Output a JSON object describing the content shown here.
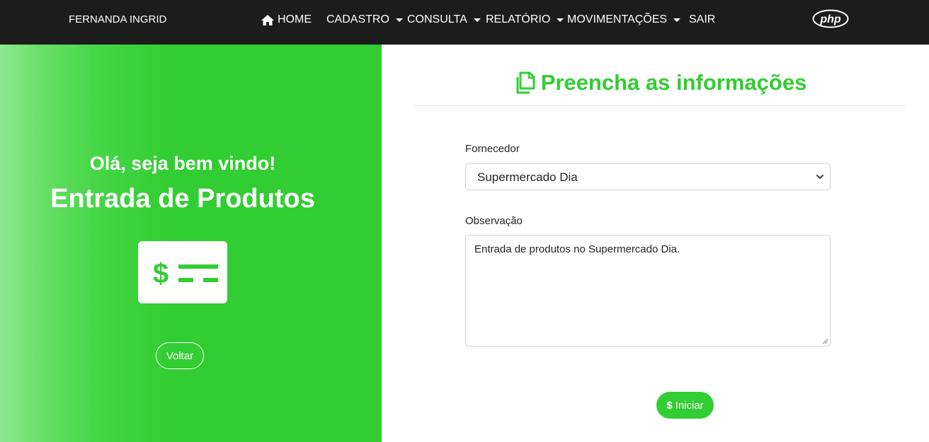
{
  "navbar": {
    "brand": "FERNANDA INGRID",
    "items": [
      {
        "label": "HOME",
        "icon": "home-icon",
        "dropdown": false
      },
      {
        "label": "CADASTRO",
        "dropdown": true
      },
      {
        "label": "CONSULTA",
        "dropdown": true
      },
      {
        "label": "RELATÓRIO",
        "dropdown": true
      },
      {
        "label": "MOVIMENTAÇÕES",
        "dropdown": true
      },
      {
        "label": "SAIR",
        "dropdown": false
      }
    ],
    "logo_text": "php"
  },
  "left_panel": {
    "welcome": "Olá, seja bem vindo!",
    "title": "Entrada de Produtos",
    "icon": "money-check-icon",
    "back_button": "Voltar"
  },
  "form": {
    "heading": "Preencha as informações",
    "heading_icon": "copy-icon",
    "supplier_label": "Fornecedor",
    "supplier_value": "Supermercado Dia",
    "notes_label": "Observação",
    "notes_value": "Entrada de produtos no Supermercado Dia.",
    "submit_icon": "$",
    "submit_label": "Iniciar"
  },
  "colors": {
    "accent": "#32cd32",
    "navbar_bg": "#1c1c1c"
  }
}
